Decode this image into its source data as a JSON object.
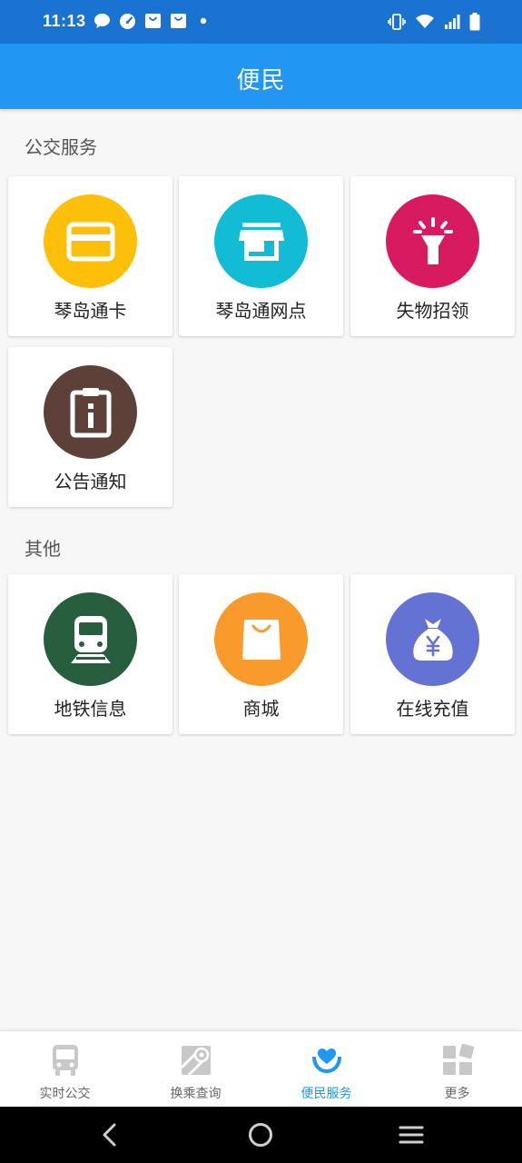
{
  "status_bar": {
    "time": "11:13",
    "left_icons": [
      "message-icon",
      "speed-icon",
      "shopping-bag-icon",
      "shopping-bag-icon",
      "dot-icon"
    ],
    "right_icons": [
      "vibrate-icon",
      "wifi-icon",
      "signal-icon",
      "battery-icon"
    ]
  },
  "app_bar": {
    "title": "便民"
  },
  "sections": [
    {
      "title": "公交服务",
      "items": [
        {
          "label": "琴岛通卡",
          "icon": "card-icon",
          "color": "#fcc00a"
        },
        {
          "label": "琴岛通网点",
          "icon": "store-icon",
          "color": "#11bcd4"
        },
        {
          "label": "失物招领",
          "icon": "flashlight-icon",
          "color": "#d81b60"
        },
        {
          "label": "公告通知",
          "icon": "clipboard-info-icon",
          "color": "#5d4037"
        }
      ]
    },
    {
      "title": "其他",
      "items": [
        {
          "label": "地铁信息",
          "icon": "train-icon",
          "color": "#275e3e"
        },
        {
          "label": "商城",
          "icon": "bag-icon",
          "color": "#f99b2c"
        },
        {
          "label": "在线充值",
          "icon": "money-bag-icon",
          "color": "#6472d3"
        }
      ]
    }
  ],
  "bottom_nav": {
    "items": [
      {
        "label": "实时公交",
        "icon": "bus-icon",
        "active": false
      },
      {
        "label": "换乘查询",
        "icon": "map-pin-icon",
        "active": false
      },
      {
        "label": "便民服务",
        "icon": "heart-hand-icon",
        "active": true
      },
      {
        "label": "更多",
        "icon": "grid-icon",
        "active": false
      }
    ],
    "active_color": "#2196f3",
    "inactive_color": "#c8c8c8"
  },
  "system_nav": {
    "buttons": [
      "back-icon",
      "home-icon",
      "recents-icon"
    ]
  }
}
